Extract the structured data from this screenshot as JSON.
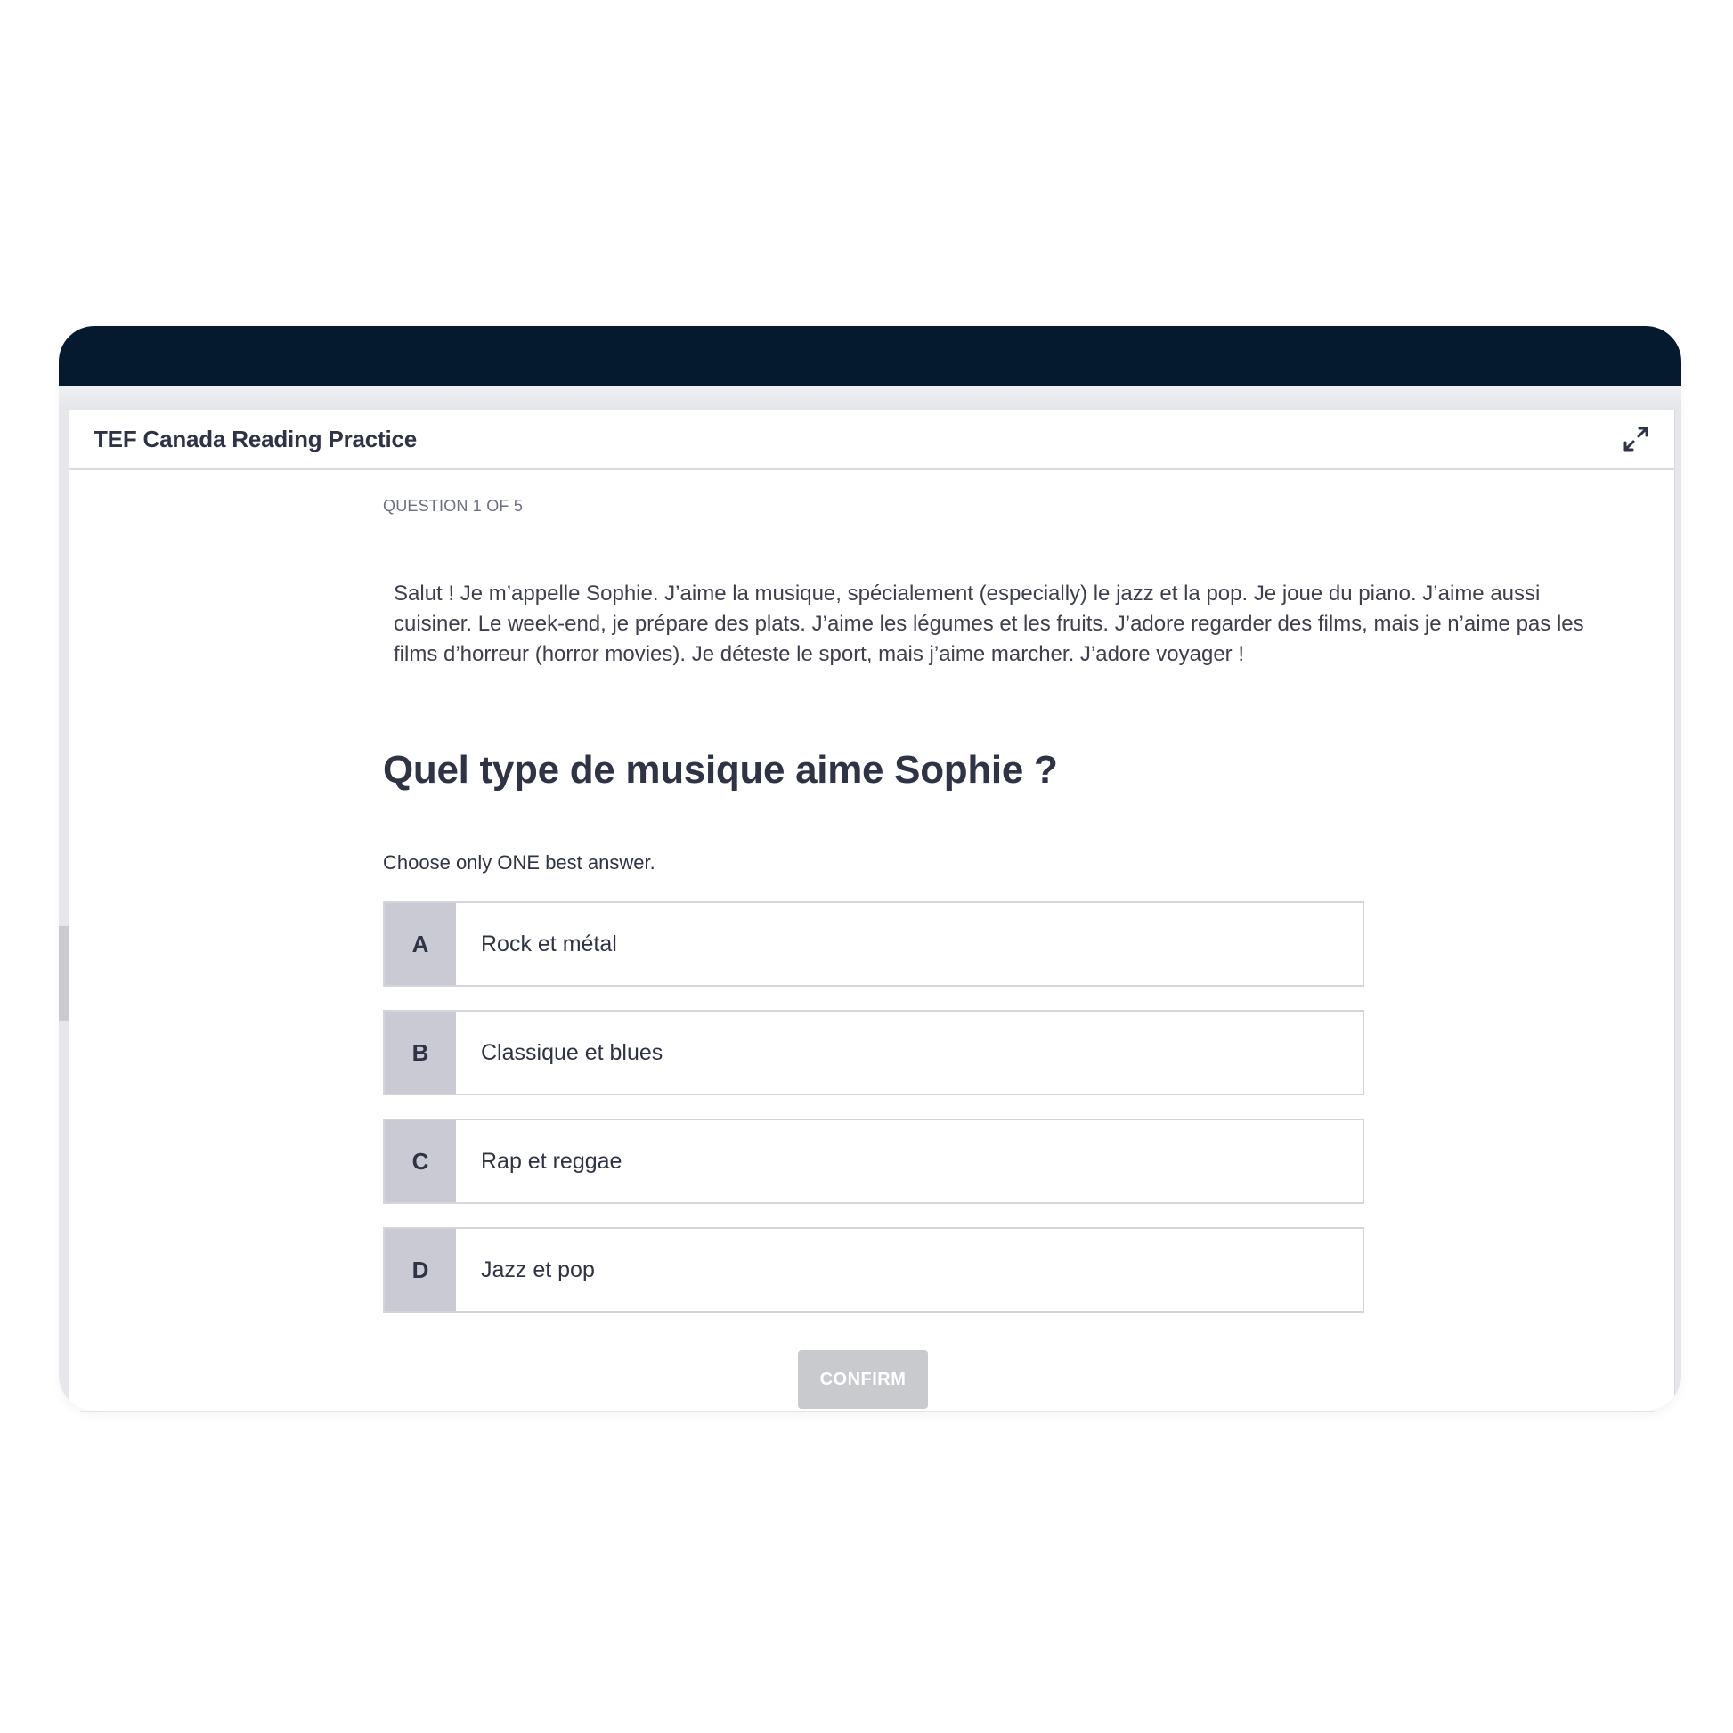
{
  "app": {
    "title": "TEF Canada Reading Practice"
  },
  "quiz": {
    "progress": "QUESTION 1 OF 5",
    "passage": "Salut ! Je m’appelle Sophie. J’aime la musique, spécialement (especially) le jazz et la pop. Je joue du piano. J’aime aussi cuisiner. Le week-end, je prépare des plats. J’aime les légumes et les fruits. J’adore regarder des films, mais je n’aime pas les films d’horreur (horror movies). Je déteste le sport, mais j’aime marcher. J’adore voyager !",
    "question": "Quel type de musique aime Sophie ?",
    "instruction": "Choose only ONE best answer.",
    "options": [
      {
        "letter": "A",
        "text": "Rock et métal"
      },
      {
        "letter": "B",
        "text": "Classique et blues"
      },
      {
        "letter": "C",
        "text": "Rap et reggae"
      },
      {
        "letter": "D",
        "text": "Jazz et pop"
      }
    ],
    "confirm_label": "CONFIRM"
  },
  "icons": {
    "expand": "expand-arrows-icon"
  },
  "colors": {
    "top_bar": "#051a2e",
    "text_primary": "#2f3346",
    "option_letter_bg": "#c9cad4",
    "confirm_disabled_bg": "#c9cace"
  }
}
